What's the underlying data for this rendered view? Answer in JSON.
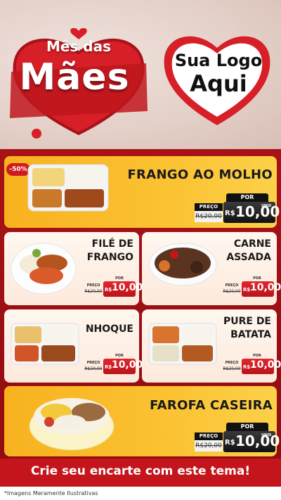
{
  "header": {
    "title_line1": "Mês das",
    "title_line2": "Mães",
    "logo_line1": "Sua Logo",
    "logo_line2": "Aqui"
  },
  "colors": {
    "brand_red": "#c3151b",
    "card_yellow": "#f8b21f",
    "dark": "#111111"
  },
  "products": [
    {
      "name": "FRANGO AO MOLHO",
      "discount": "-50%",
      "price_label": "PREÇO",
      "old_price": "R$20,00",
      "per_label": "POR",
      "currency": "R$",
      "new_price": "10,00",
      "unit": "UNID"
    },
    {
      "name_line1": "FILÉ DE",
      "name_line2": "FRANGO",
      "price_label": "PREÇO",
      "old_price": "R$20,00",
      "per_label": "POR",
      "currency": "R$",
      "new_price": "10,00",
      "unit": "UNID"
    },
    {
      "name_line1": "CARNE",
      "name_line2": "ASSADA",
      "price_label": "PREÇO",
      "old_price": "R$20,00",
      "per_label": "POR",
      "currency": "R$",
      "new_price": "10,00",
      "unit": "UNID"
    },
    {
      "name": "NHOQUE",
      "price_label": "PREÇO",
      "old_price": "R$20,00",
      "per_label": "POR",
      "currency": "R$",
      "new_price": "10,00",
      "unit": "UNID"
    },
    {
      "name_line1": "PURE DE",
      "name_line2": "BATATA",
      "price_label": "PREÇO",
      "old_price": "R$20,00",
      "per_label": "POR",
      "currency": "R$",
      "new_price": "10,00",
      "unit": "UNID"
    },
    {
      "name": "FAROFA CASEIRA",
      "price_label": "PREÇO",
      "old_price": "R$20,00",
      "per_label": "POR",
      "currency": "R$",
      "new_price": "10,00",
      "unit": "UNID"
    }
  ],
  "footer": {
    "cta": "Crie seu encarte com este tema!",
    "disclaimer": "*Imagens Meramente Ilustrativas"
  }
}
